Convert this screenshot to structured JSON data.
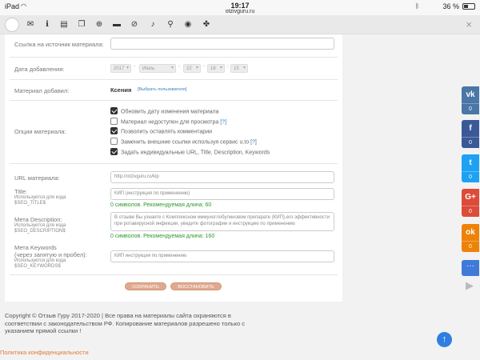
{
  "statusbar": {
    "device": "iPad",
    "wifi_icon": "wifi-icon",
    "time": "19:17",
    "url": "otzivguru.ru",
    "bluetooth_icon": "bluetooth-icon",
    "battery_text": "36 %",
    "battery_level": 0.36
  },
  "toolbar": {
    "icons": [
      "mail-icon",
      "info-icon",
      "document-icon",
      "copy-icon",
      "add-icon",
      "folder-icon",
      "ban-icon",
      "bell-icon",
      "search-icon",
      "eye-icon",
      "puzzle-icon"
    ],
    "close": "×"
  },
  "form": {
    "source_link": {
      "label": "Ссылка на источник материала:",
      "value": ""
    },
    "date_added": {
      "label": "Дата добавления:",
      "year": "2017",
      "month": "Июль",
      "day": "22",
      "hour": "18",
      "minute": "15",
      "sep_dash": "-",
      "sep_colon": ":"
    },
    "author": {
      "label": "Материал добавил:",
      "name": "Ксения",
      "choose_link": "[Выбрать пользователя]"
    },
    "options": {
      "label": "Опции материала:",
      "items": [
        {
          "text": "Обновить дату изменения материала",
          "checked": true,
          "help": ""
        },
        {
          "text": "Материал недоступен для просмотра",
          "checked": false,
          "help": "[?]"
        },
        {
          "text": "Позволить оставлять комментарии",
          "checked": true,
          "help": ""
        },
        {
          "text": "Заменить внешние ссылки используя сервис u.to",
          "checked": false,
          "help": "[?]"
        },
        {
          "text": "Задать индивидуальные URL, Title, Description, Keywords",
          "checked": true,
          "help": ""
        }
      ]
    },
    "url": {
      "label": "URL материала:",
      "value": "http://otzivguru.ru/kip"
    },
    "title": {
      "label": "Title:",
      "sub1": "Используется для кода",
      "sub2": "$SEO_TITLE$",
      "value": "КИП (инструкция по применению)",
      "counter": "0 символов. Рекомендуемая длина: 60"
    },
    "description": {
      "label": "Мета Description:",
      "sub1": "Используется для кода",
      "sub2": "$SEO_DESCRIPTION$",
      "value": "В отзыве Вы узнаете с Комплексном иммуноглобулиновом препарате (КИП),его эффективности при ротавирусной инфекции, увидите фотографии и инструкцию по применению",
      "counter": "0 символов. Рекомендуемая длина: 160"
    },
    "keywords": {
      "label": "Мета Keywords",
      "label2": "(через запятую и пробел):",
      "sub1": "Используется для кода",
      "sub2": "$SEO_KEYWORDS$",
      "value": "КИП инструкция по применению"
    },
    "buttons": {
      "save": "СОХРАНИТЬ",
      "restore": "ВОССТАНОВИТЬ"
    }
  },
  "footer": {
    "copyright": "Copyright © Отзыв Гуру 2017-2020 | Все права на материалы сайта охраняются в соответствии с законодательством РФ. Копирование материалов разрешено только с указанием прямой ссылки !",
    "privacy": "Политика конфиденциальности",
    "to_top": "↑"
  },
  "share": [
    {
      "network": "vk",
      "icon": "vk-icon",
      "label": "vk",
      "count": "0",
      "color": "#4a76a8"
    },
    {
      "network": "facebook",
      "icon": "facebook-icon",
      "label": "f",
      "count": "0",
      "color": "#3b5998"
    },
    {
      "network": "twitter",
      "icon": "twitter-icon",
      "label": "t",
      "count": "0",
      "color": "#1da1f2"
    },
    {
      "network": "googleplus",
      "icon": "googleplus-icon",
      "label": "G+",
      "count": "0",
      "color": "#dd4b39"
    },
    {
      "network": "odnoklassniki",
      "icon": "odnoklassniki-icon",
      "label": "ok",
      "count": "0",
      "color": "#ee8208"
    }
  ],
  "share_more": "···",
  "share_collapse": "▶"
}
